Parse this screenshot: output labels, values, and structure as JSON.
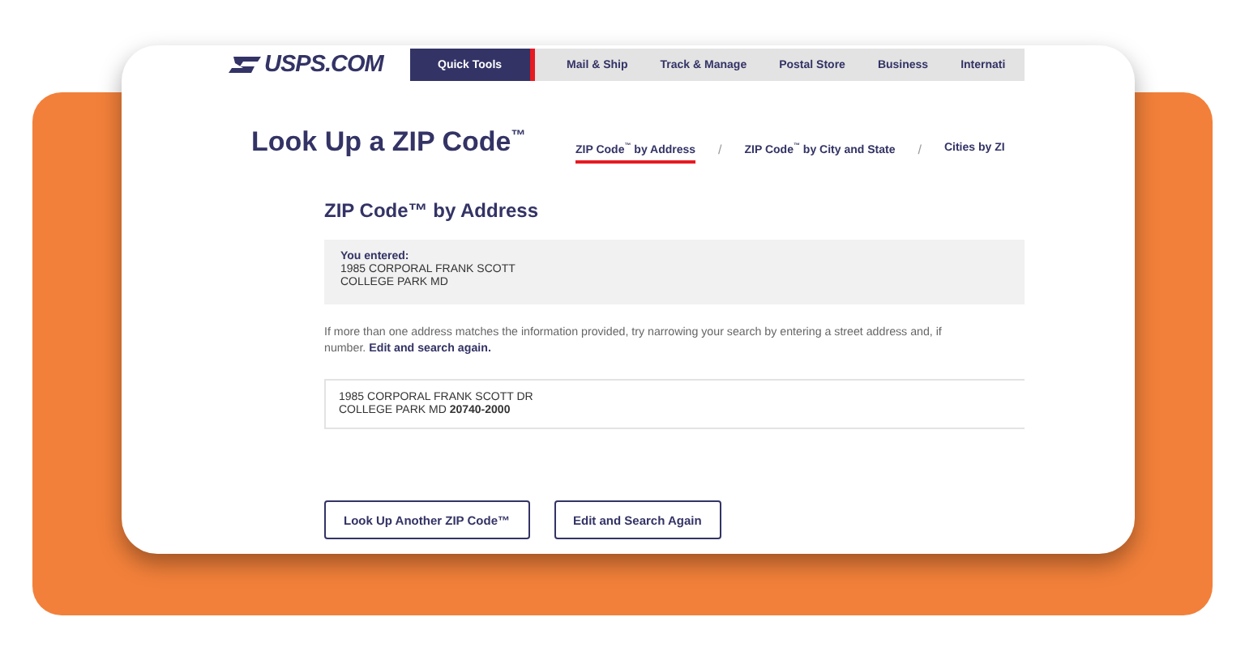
{
  "logo": {
    "text": "USPS.COM"
  },
  "nav": [
    {
      "label": "Quick Tools",
      "selected": true
    },
    {
      "label": "Mail & Ship",
      "selected": false
    },
    {
      "label": "Track & Manage",
      "selected": false
    },
    {
      "label": "Postal Store",
      "selected": false
    },
    {
      "label": "Business",
      "selected": false
    },
    {
      "label": "Internati",
      "selected": false
    }
  ],
  "page_title": "Look Up a ZIP Code$^{™}$",
  "tabs": [
    {
      "label": "ZIP Code$^{™}$ by Address",
      "selected": true
    },
    {
      "label": "ZIP Code$^{™}$ by City and State",
      "selected": false
    },
    {
      "label": "Cities by ZI",
      "selected": false
    }
  ],
  "tab_separators": [
    "/",
    "/"
  ],
  "section_title": "ZIP Code™ by Address",
  "entered": {
    "label": "You entered:",
    "lines": [
      "1985 CORPORAL FRANK SCOTT",
      "COLLEGE PARK MD"
    ]
  },
  "help": {
    "line_1": "If more than one address matches the information provided, try narrowing your search by entering a street address and, if",
    "line_2": "number.",
    "link": "Edit and search again."
  },
  "results": [
    {
      "lines": [
        "1985 CORPORAL FRANK SCOTT DR",
        "COLLEGE PARK MD **20740-2000**"
      ]
    }
  ],
  "buttons": [
    "Look Up Another ZIP Code™",
    "Edit and Search Again"
  ]
}
